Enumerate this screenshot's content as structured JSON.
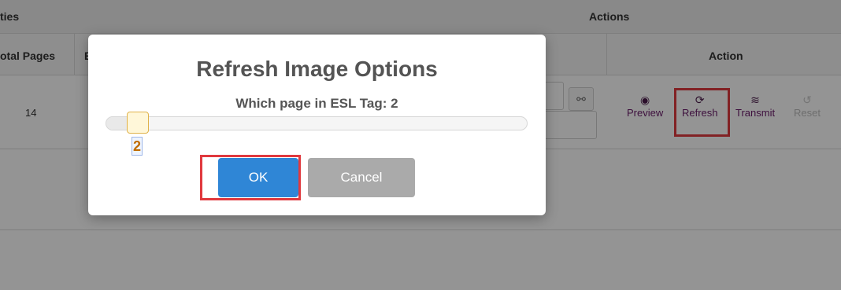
{
  "table": {
    "group_left": "ties",
    "group_actions": "Actions",
    "col_total_pages": "otal Pages",
    "col_e": "E",
    "col_action": "Action",
    "row1_total_pages": "14",
    "actions": [
      {
        "label": "Preview",
        "icon": "eye-icon",
        "glyph": "◉"
      },
      {
        "label": "Refresh",
        "icon": "refresh-icon",
        "glyph": "⟳"
      },
      {
        "label": "Transmit",
        "icon": "wifi-icon",
        "glyph": "≋"
      },
      {
        "label": "Reset",
        "icon": "undo-icon",
        "glyph": "↺"
      }
    ]
  },
  "modal": {
    "title": "Refresh Image Options",
    "subtitle": "Which page in ESL Tag: 2",
    "slider_value": "2",
    "slider_fraction": 0.05,
    "ok_label": "OK",
    "cancel_label": "Cancel"
  },
  "colors": {
    "ok_button": "#2f86d6",
    "cancel_button": "#aaaaaa",
    "highlight": "#e0393e",
    "action_text": "#6a1b6a"
  }
}
